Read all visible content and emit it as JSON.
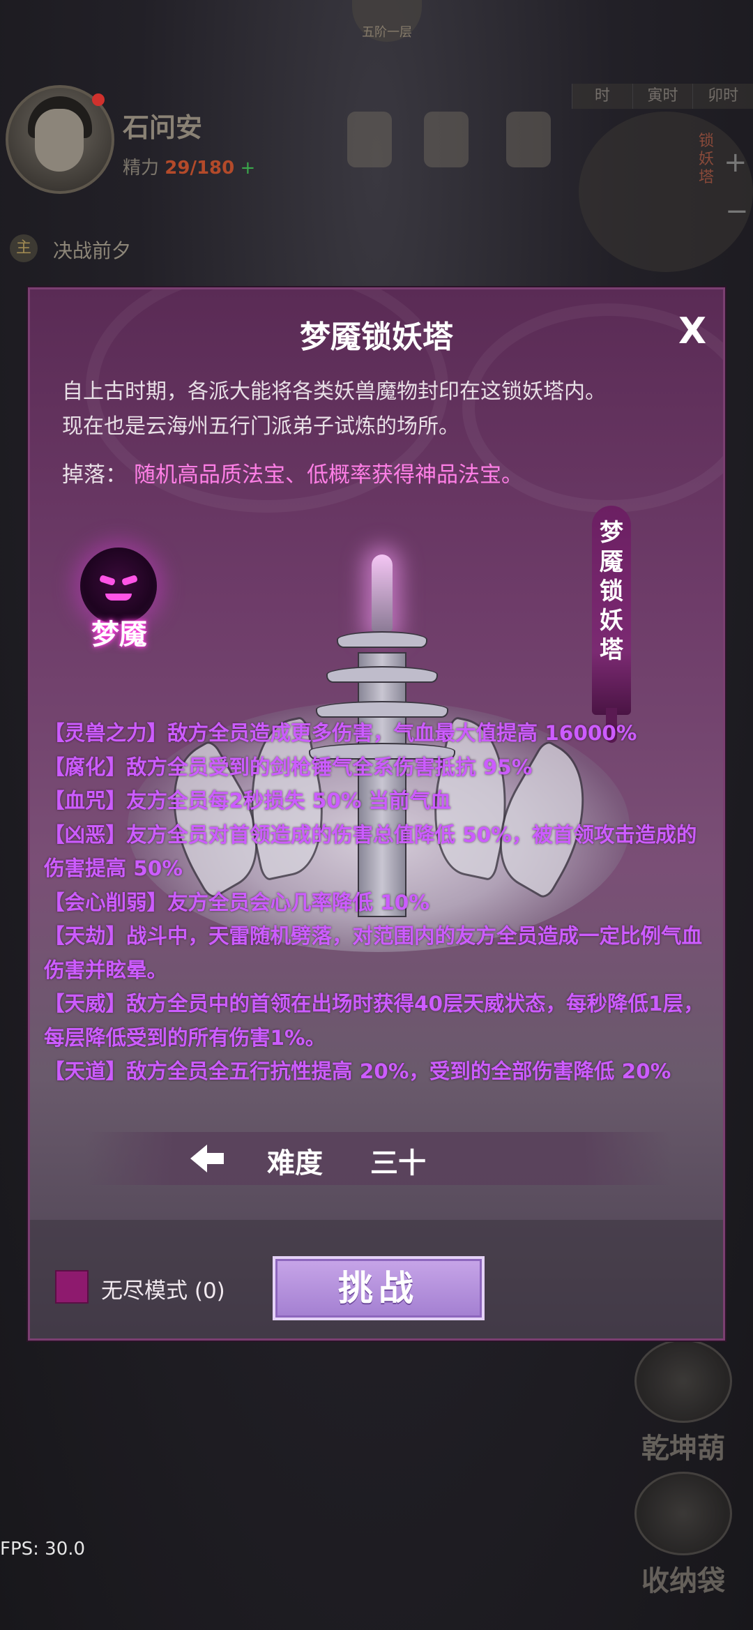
{
  "hud": {
    "top_emblem": "五阶一层",
    "player_name": "石问安",
    "energy_label": "精力",
    "energy_value": "29/180",
    "energy_plus": "+",
    "time_tabs": [
      "时",
      "寅时",
      "卯时"
    ],
    "tower_mini_label": "锁妖塔",
    "zoom_in": "+",
    "zoom_out": "−",
    "quest_tag": "主",
    "quest_title": "决战前夕",
    "side_buttons": [
      "乾坤葫",
      "收纳袋"
    ],
    "fps": "FPS: 30.0"
  },
  "modal": {
    "title": "梦魇锁妖塔",
    "close": "X",
    "description": [
      "自上古时期，各派大能将各类妖兽魔物封印在这锁妖塔内。",
      "现在也是云海州五行门派弟子试炼的场所。"
    ],
    "drop_label": "掉落：",
    "drop_value": "随机高品质法宝、低概率获得神品法宝。",
    "boss_name": "梦魇",
    "banner_text": "梦魇锁妖塔",
    "effects": [
      "【灵兽之力】敌方全员造成更多伤害，气血最大值提高 16000%",
      "【腐化】敌方全员受到的剑枪锤气全系伤害抵抗 95%",
      "【血咒】友方全员每2秒损失 50% 当前气血",
      "【凶恶】友方全员对首领造成的伤害总值降低 50%，被首领攻击造成的伤害提高 50%",
      "【会心削弱】友方全员会心几率降低 10%",
      "【天劫】战斗中，天雷随机劈落，对范围内的友方全员造成一定比例气血伤害并眩晕。",
      "【天威】敌方全员中的首领在出场时获得40层天威状态，每秒降低1层，每层降低受到的所有伤害1%。",
      "【天道】敌方全员全五行抗性提高 20%，受到的全部伤害降低 20%"
    ],
    "difficulty_label": "难度",
    "difficulty_value": "三十",
    "endless_label": "无尽模式 (0)",
    "challenge_label": "挑战"
  },
  "colors": {
    "modal_border": "#7b3f71",
    "effect_text": "#cc5cff",
    "drop_value": "#ff7fe6",
    "checkbox": "#8e1a6e",
    "challenge_button": "#b28fdc"
  },
  "icons": [
    "close-icon",
    "boss-skull-icon",
    "left-arrow-icon",
    "tower-icon",
    "avatar"
  ]
}
